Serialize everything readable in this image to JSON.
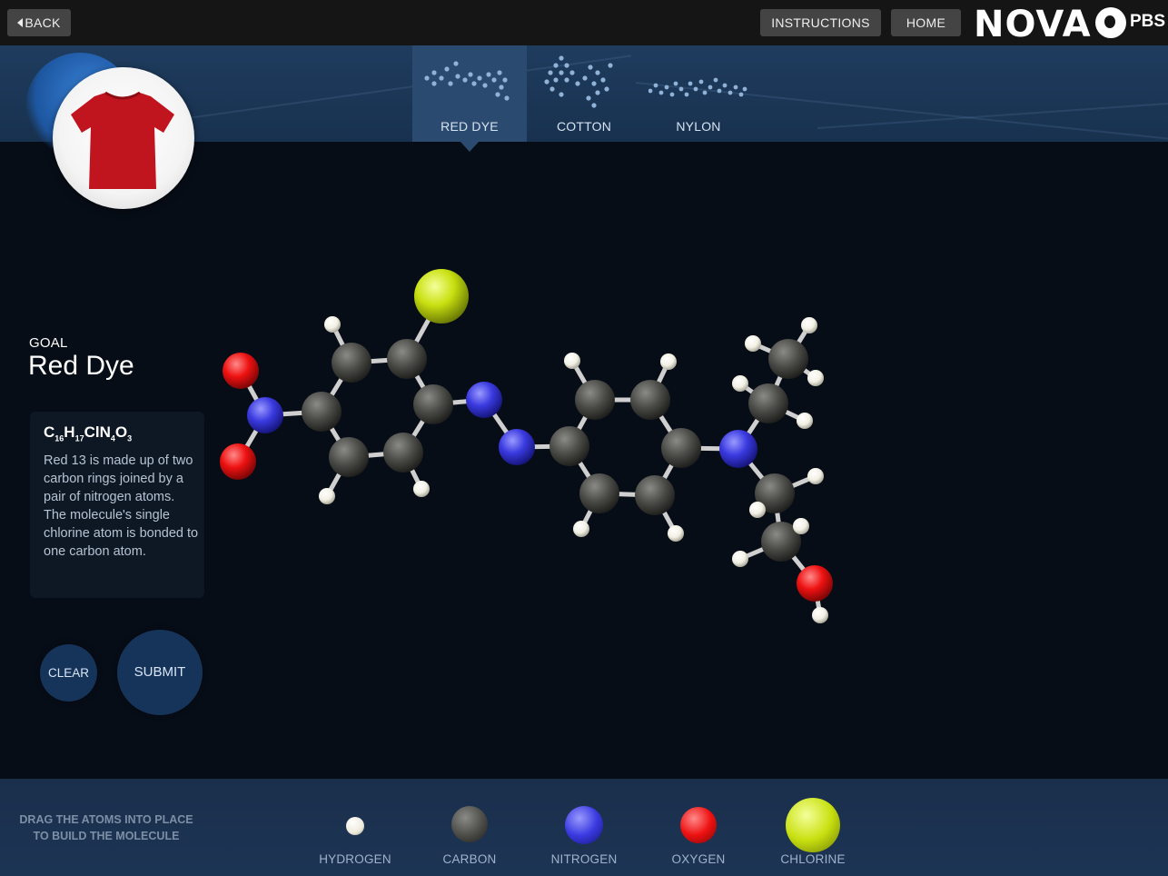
{
  "topbar": {
    "back_label": "BACK",
    "instructions_label": "INSTRUCTIONS",
    "home_label": "HOME",
    "nova_logo": "NOVA",
    "pbs_logo": "PBS"
  },
  "tabs": [
    {
      "label": "RED DYE",
      "selected": true
    },
    {
      "label": "COTTON",
      "selected": false
    },
    {
      "label": "NYLON",
      "selected": false
    }
  ],
  "goal": {
    "label": "GOAL",
    "title": "Red Dye",
    "formula": {
      "c": "C",
      "c_n": "16",
      "h": "H",
      "h_n": "17",
      "cl": "Cl",
      "n": "N",
      "n_n": "4",
      "o": "O",
      "o_n": "3"
    },
    "description": "Red 13 is made up of two carbon rings joined by a pair of nitrogen atoms. The molecule's single chlorine atom is bonded to one carbon atom."
  },
  "actions": {
    "clear_label": "CLEAR",
    "submit_label": "SUBMIT"
  },
  "palette": {
    "hint": "DRAG THE ATOMS INTO PLACE TO BUILD THE MOLECULE",
    "atoms": [
      {
        "label": "HYDROGEN",
        "color": "#ffffff"
      },
      {
        "label": "CARBON",
        "color": "#4a4a48"
      },
      {
        "label": "NITROGEN",
        "color": "#3a3ae0"
      },
      {
        "label": "OXYGEN",
        "color": "#ee1111"
      },
      {
        "label": "CHLORINE",
        "color": "#c8e010"
      }
    ]
  },
  "colors": {
    "shirt": "#c0141e",
    "tab_selected_bg": "#2b4a6f",
    "bond": "#cfcfcf"
  },
  "icons": [
    "back-arrow-icon",
    "nova-logo",
    "pbs-logo-icon",
    "t-shirt-icon",
    "red-dye-molecule-icon",
    "cotton-molecule-icon",
    "nylon-molecule-icon"
  ]
}
